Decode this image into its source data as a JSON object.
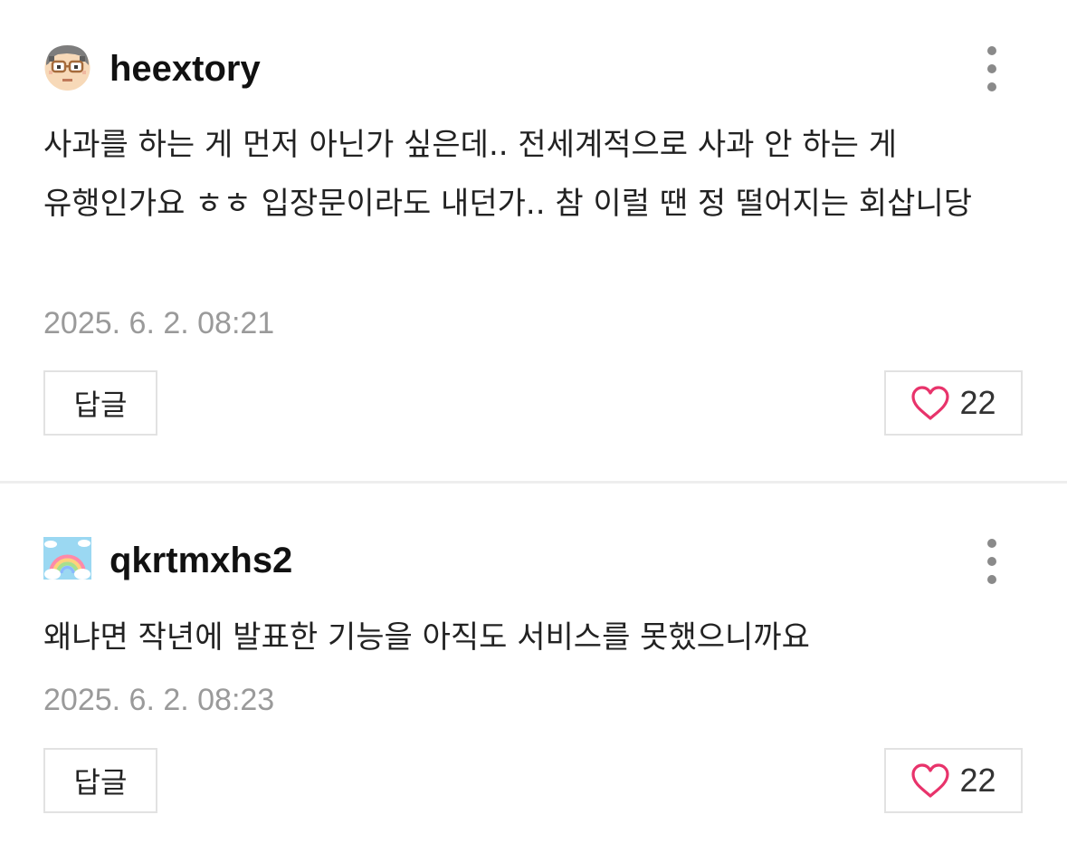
{
  "comments": [
    {
      "username": "heextory",
      "avatar_icon": "pixel-character-avatar-icon",
      "text": "사과를 하는 게 먼저 아닌가 싶은데.. 전세계적으로 사과 안 하는 게 유행인가요 ㅎㅎ 입장문이라도 내던가.. 참 이럴 땐 정 떨어지는 회삽니당",
      "timestamp": "2025. 6. 2. 08:21",
      "reply_label": "답글",
      "like_count": "22",
      "more_icon": "more-vertical-icon",
      "like_icon": "heart-outline-icon"
    },
    {
      "username": "qkrtmxhs2",
      "avatar_icon": "rainbow-clouds-avatar-icon",
      "text": "왜냐면 작년에 발표한 기능을 아직도 서비스를 못했으니까요",
      "timestamp": "2025. 6. 2. 08:23",
      "reply_label": "답글",
      "like_count": "22",
      "more_icon": "more-vertical-icon",
      "like_icon": "heart-outline-icon"
    }
  ],
  "colors": {
    "heart": "#e8336b",
    "timestamp": "#9a9a9a",
    "border": "#e2e2e2",
    "divider": "#eeeeee",
    "text": "#222222"
  }
}
